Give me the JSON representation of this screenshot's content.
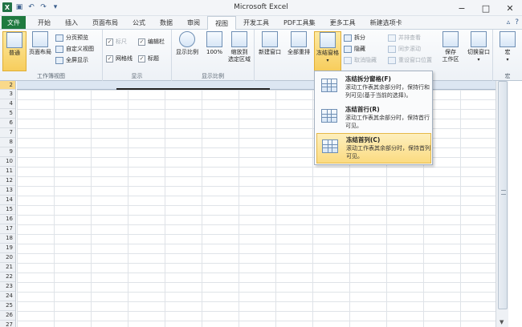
{
  "window": {
    "title": "Microsoft Excel",
    "minimize": "−",
    "maximize": "□",
    "close": "✕"
  },
  "qat": {
    "undo": "↶",
    "redo": "↷",
    "customize": "▾"
  },
  "tabs": [
    "文件",
    "开始",
    "插入",
    "页面布局",
    "公式",
    "数据",
    "审阅",
    "视图",
    "开发工具",
    "PDF工具集",
    "更多工具",
    "新建选项卡"
  ],
  "active_tab": "视图",
  "ribbon": {
    "workbook_views": {
      "label": "工作簿视图",
      "normal": "普通",
      "page_layout": "页面布局",
      "page_break": "分页预览",
      "custom_views": "自定义视图",
      "full_screen": "全屏显示"
    },
    "show": {
      "label": "显示",
      "ruler": "标尺",
      "gridlines": "网格线",
      "formula_bar": "编辑栏",
      "headings": "标题",
      "ruler_checked": true,
      "gridlines_checked": true,
      "formula_bar_checked": true,
      "headings_checked": true
    },
    "zoom": {
      "label": "显示比例",
      "zoom": "显示比例",
      "hundred": "100%",
      "zoom_selection_l1": "缩放到",
      "zoom_selection_l2": "选定区域"
    },
    "window": {
      "new_window": "新建窗口",
      "arrange_all": "全部重排",
      "freeze_panes": "冻结窗格",
      "split": "拆分",
      "hide": "隐藏",
      "unhide": "取消隐藏",
      "side_by_side": "并排查看",
      "sync_scroll": "同步滚动",
      "reset_position": "重设窗口位置",
      "save_workspace_l1": "保存",
      "save_workspace_l2": "工作区",
      "switch_windows": "切换窗口"
    },
    "macros": {
      "label": "宏",
      "macros": "宏"
    }
  },
  "freeze_menu": [
    {
      "title": "冻结拆分窗格(F)",
      "desc": "滚动工作表其余部分时，保持行和列可见(基于当前的选择)。",
      "highlighted": false
    },
    {
      "title": "冻结首行(R)",
      "desc": "滚动工作表其余部分时，保持首行可见。",
      "highlighted": false
    },
    {
      "title": "冻结首列(C)",
      "desc": "滚动工作表其余部分时，保持首列可见。",
      "highlighted": true
    }
  ],
  "rows": [
    "2",
    "3",
    "4",
    "5",
    "6",
    "7",
    "8",
    "9",
    "10",
    "11",
    "12",
    "13",
    "14",
    "15",
    "16",
    "17",
    "18",
    "19",
    "20",
    "21",
    "22",
    "23",
    "24",
    "25",
    "26",
    "27"
  ],
  "colors": {
    "file_tab": "#1f7a3f",
    "highlight": "#f9d98a",
    "ribbon_bg": "#edf1f6"
  }
}
